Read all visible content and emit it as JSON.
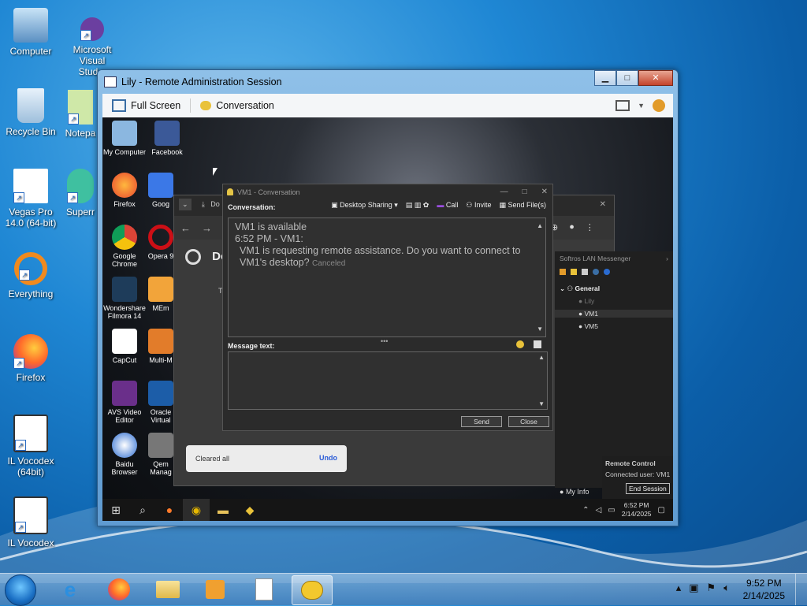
{
  "desktop": {
    "icons": [
      {
        "label": "Computer"
      },
      {
        "label": "Microsoft Visual Stud..."
      },
      {
        "label": "Recycle Bin"
      },
      {
        "label": "Notepa"
      },
      {
        "label": "Vegas Pro 14.0 (64-bit)"
      },
      {
        "label": "Superr"
      },
      {
        "label": "Everything"
      },
      {
        "label": "Firefox"
      },
      {
        "label": "IL Vocodex (64bit)"
      },
      {
        "label": "IL Vocodex"
      }
    ]
  },
  "window": {
    "title": "Lily - Remote Administration Session",
    "toolbar": {
      "full_screen": "Full Screen",
      "conversation": "Conversation"
    }
  },
  "remote": {
    "desktop_icons": [
      {
        "label": "My Computer"
      },
      {
        "label": "Facebook"
      },
      {
        "label": "Firefox"
      },
      {
        "label": "Goog"
      },
      {
        "label": "Google Chrome"
      },
      {
        "label": "Opera 9"
      },
      {
        "label": "Wondershare Filmora 14"
      },
      {
        "label": "MEm"
      },
      {
        "label": "CapCut"
      },
      {
        "label": "Multi-M"
      },
      {
        "label": "AVS Video Editor"
      },
      {
        "label": "Oracle Virtual"
      },
      {
        "label": "Baidu Browser"
      },
      {
        "label": "Qem Manag"
      }
    ],
    "chrome": {
      "tab_text": "Do",
      "page_heading": "Do",
      "partial_text": "To"
    },
    "conversation": {
      "title": "VM1 - Conversation",
      "conversation_label": "Conversation:",
      "actions": [
        "Desktop Sharing",
        "Call",
        "Invite",
        "Send File(s)"
      ],
      "log": {
        "line1": "VM1 is available",
        "line2": "6:52 PM - VM1:",
        "line3": "VM1 is requesting remote assistance. Do you want to connect to VM1's desktop?",
        "status": "Canceled"
      },
      "message_label": "Message text:",
      "send": "Send",
      "close": "Close"
    },
    "toast": {
      "text": "Cleared all",
      "action": "Undo"
    },
    "lan": {
      "title": "Softros LAN Messenger",
      "group": "General",
      "users": [
        "Lily",
        "VM1",
        "VM5"
      ]
    },
    "remote_control": {
      "title": "Remote Control",
      "status": "Connected user: VM1",
      "end": "End Session"
    },
    "my_info": "My Info",
    "clock": {
      "time": "6:52 PM",
      "date": "2/14/2025"
    }
  },
  "taskbar": {
    "clock": {
      "time": "9:52 PM",
      "date": "2/14/2025"
    }
  },
  "colors": {
    "accent": "#1f87d4",
    "toast_action": "#2a5bd7"
  }
}
